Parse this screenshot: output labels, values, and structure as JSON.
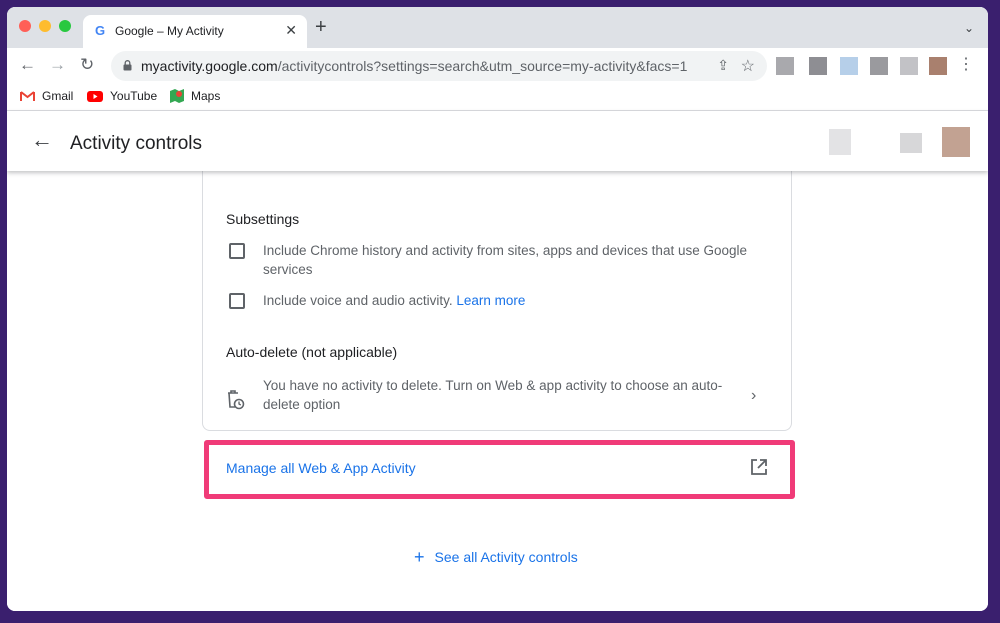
{
  "browser": {
    "tab_title": "Google – My Activity",
    "url_host": "myactivity.google.com",
    "url_path": "/activitycontrols?settings=search&utm_source=my-activity&facs=1",
    "bookmarks": [
      {
        "label": "Gmail",
        "icon": "gmail-icon"
      },
      {
        "label": "YouTube",
        "icon": "youtube-icon"
      },
      {
        "label": "Maps",
        "icon": "maps-icon"
      }
    ]
  },
  "header": {
    "title": "Activity controls"
  },
  "card": {
    "subsettings_title": "Subsettings",
    "options": [
      {
        "text": "Include Chrome history and activity from sites, apps and devices that use Google services",
        "checked": false
      },
      {
        "text": "Include voice and audio activity.",
        "link": "Learn more",
        "checked": false
      }
    ],
    "autodelete_title": "Auto-delete (not applicable)",
    "autodelete_text": "You have no activity to delete. Turn on Web & app activity to choose an auto-delete option"
  },
  "manage_link": "Manage all Web & App Activity",
  "see_all_link": "See all Activity controls",
  "colors": {
    "accent_blue": "#1a73e8",
    "highlight_pink": "#f03b78",
    "window_bg": "#3a1f6e"
  }
}
